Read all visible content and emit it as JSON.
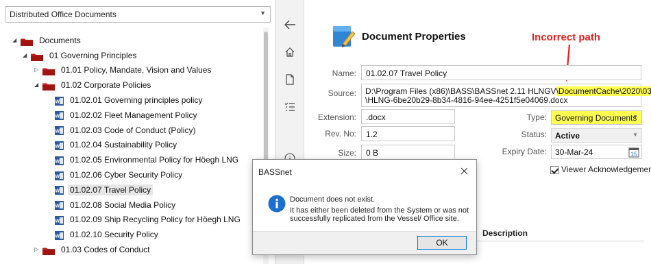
{
  "left": {
    "library_select": "Distributed Office Documents",
    "tree": [
      {
        "label": "Documents",
        "icon": "folder",
        "arrow": "expanded",
        "level": 0
      },
      {
        "label": "01 Governing Principles",
        "icon": "folder",
        "arrow": "expanded",
        "level": 1
      },
      {
        "label": "01.01 Policy, Mandate, Vision and Values",
        "icon": "folder",
        "arrow": "collapsed",
        "level": 2
      },
      {
        "label": "01.02 Corporate Policies",
        "icon": "folder",
        "arrow": "expanded",
        "level": 2
      },
      {
        "label": "01.02.01 Governing principles policy",
        "icon": "word-doc",
        "arrow": "none",
        "level": 3
      },
      {
        "label": "01.02.02 Fleet Management Policy",
        "icon": "word-doc",
        "arrow": "none",
        "level": 3
      },
      {
        "label": "01.02.03 Code of Conduct (Policy)",
        "icon": "word-doc",
        "arrow": "none",
        "level": 3
      },
      {
        "label": "01.02.04 Sustainability Policy",
        "icon": "word-doc",
        "arrow": "none",
        "level": 3
      },
      {
        "label": "01.02.05 Environmental Policy for Höegh LNG",
        "icon": "word-doc",
        "arrow": "none",
        "level": 3
      },
      {
        "label": "01.02.06 Cyber Security Policy",
        "icon": "word-doc",
        "arrow": "none",
        "level": 3
      },
      {
        "label": "01.02.07 Travel Policy",
        "icon": "word-doc",
        "arrow": "none",
        "level": 3,
        "selected": true
      },
      {
        "label": "01.02.08 Social Media Policy",
        "icon": "word-doc",
        "arrow": "none",
        "level": 3
      },
      {
        "label": "01.02.09 Ship Recycling Policy for Höegh LNG",
        "icon": "word-doc",
        "arrow": "none",
        "level": 3
      },
      {
        "label": "01.02.10 Security Policy",
        "icon": "word-doc",
        "arrow": "none",
        "level": 3
      },
      {
        "label": "01.03 Codes of Conduct",
        "icon": "folder",
        "arrow": "collapsed",
        "level": 2
      }
    ]
  },
  "toolbar": {
    "icons": [
      "back-arrow-icon",
      "home-icon",
      "document-icon",
      "checklist-icon",
      "info-icon"
    ]
  },
  "props": {
    "title": "Document Properties",
    "annotation": "Incorrect path",
    "name_label": "Name:",
    "name_value": "01.02.07 Travel Policy",
    "source_label": "Source:",
    "source_line1_plain": "D:\\Program Files (x86)\\BASS\\BASSnet 2.11 HLNGV",
    "source_line1_highlight": "\\DocumentCache\\2020\\03",
    "source_line2": "\\HLNG-6be20b29-8b34-4816-94ee-4251f5e04069.docx",
    "extension_label": "Extension:",
    "extension_value": ".docx",
    "revno_label": "Rev. No:",
    "revno_value": "1.2",
    "size_label": "Size:",
    "size_value": "0 B",
    "type_label": "Type:",
    "type_value": "Governing Documents",
    "status_label": "Status:",
    "status_value": "Active",
    "expiry_label": "Expiry Date:",
    "expiry_value": "30-Mar-24",
    "calendar_day": "15",
    "ack_label": "Viewer Acknowledgement",
    "description_header": "Description"
  },
  "dialog": {
    "title": "BASSnet",
    "message_line1": "Document does not exist.",
    "message_line2": "It has either been deleted from the System or was not successfully replicated from the Vessel/ Office site.",
    "ok_label": "OK"
  },
  "colors": {
    "folder_red": "#c8201b",
    "word_blue": "#2b5a9f",
    "highlight": "#ffff52",
    "annotation_red": "#e0201b",
    "info_blue": "#1a6fd0"
  }
}
